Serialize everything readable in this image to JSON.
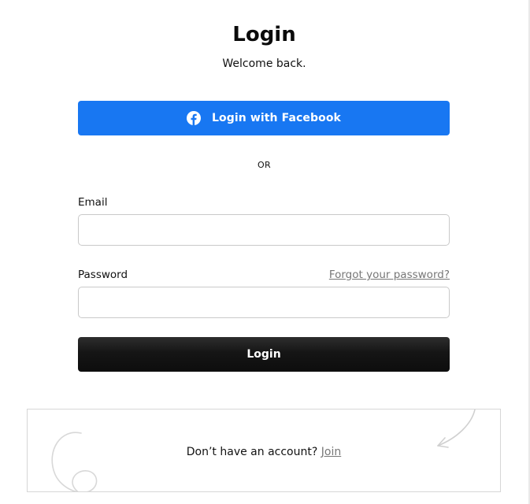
{
  "header": {
    "title": "Login",
    "subtitle": "Welcome back."
  },
  "social": {
    "facebook_label": "Login with Facebook",
    "icon": "facebook-icon",
    "color": "#1877f2"
  },
  "divider": {
    "text": "OR"
  },
  "form": {
    "email_label": "Email",
    "email_value": "",
    "password_label": "Password",
    "password_value": "",
    "forgot_label": "Forgot your password?",
    "submit_label": "Login"
  },
  "signup": {
    "prompt": "Don’t have an account?",
    "join_label": "Join"
  },
  "colors": {
    "primary_dark": "#111111",
    "link_gray": "#777777",
    "border": "#c9c9c9"
  }
}
